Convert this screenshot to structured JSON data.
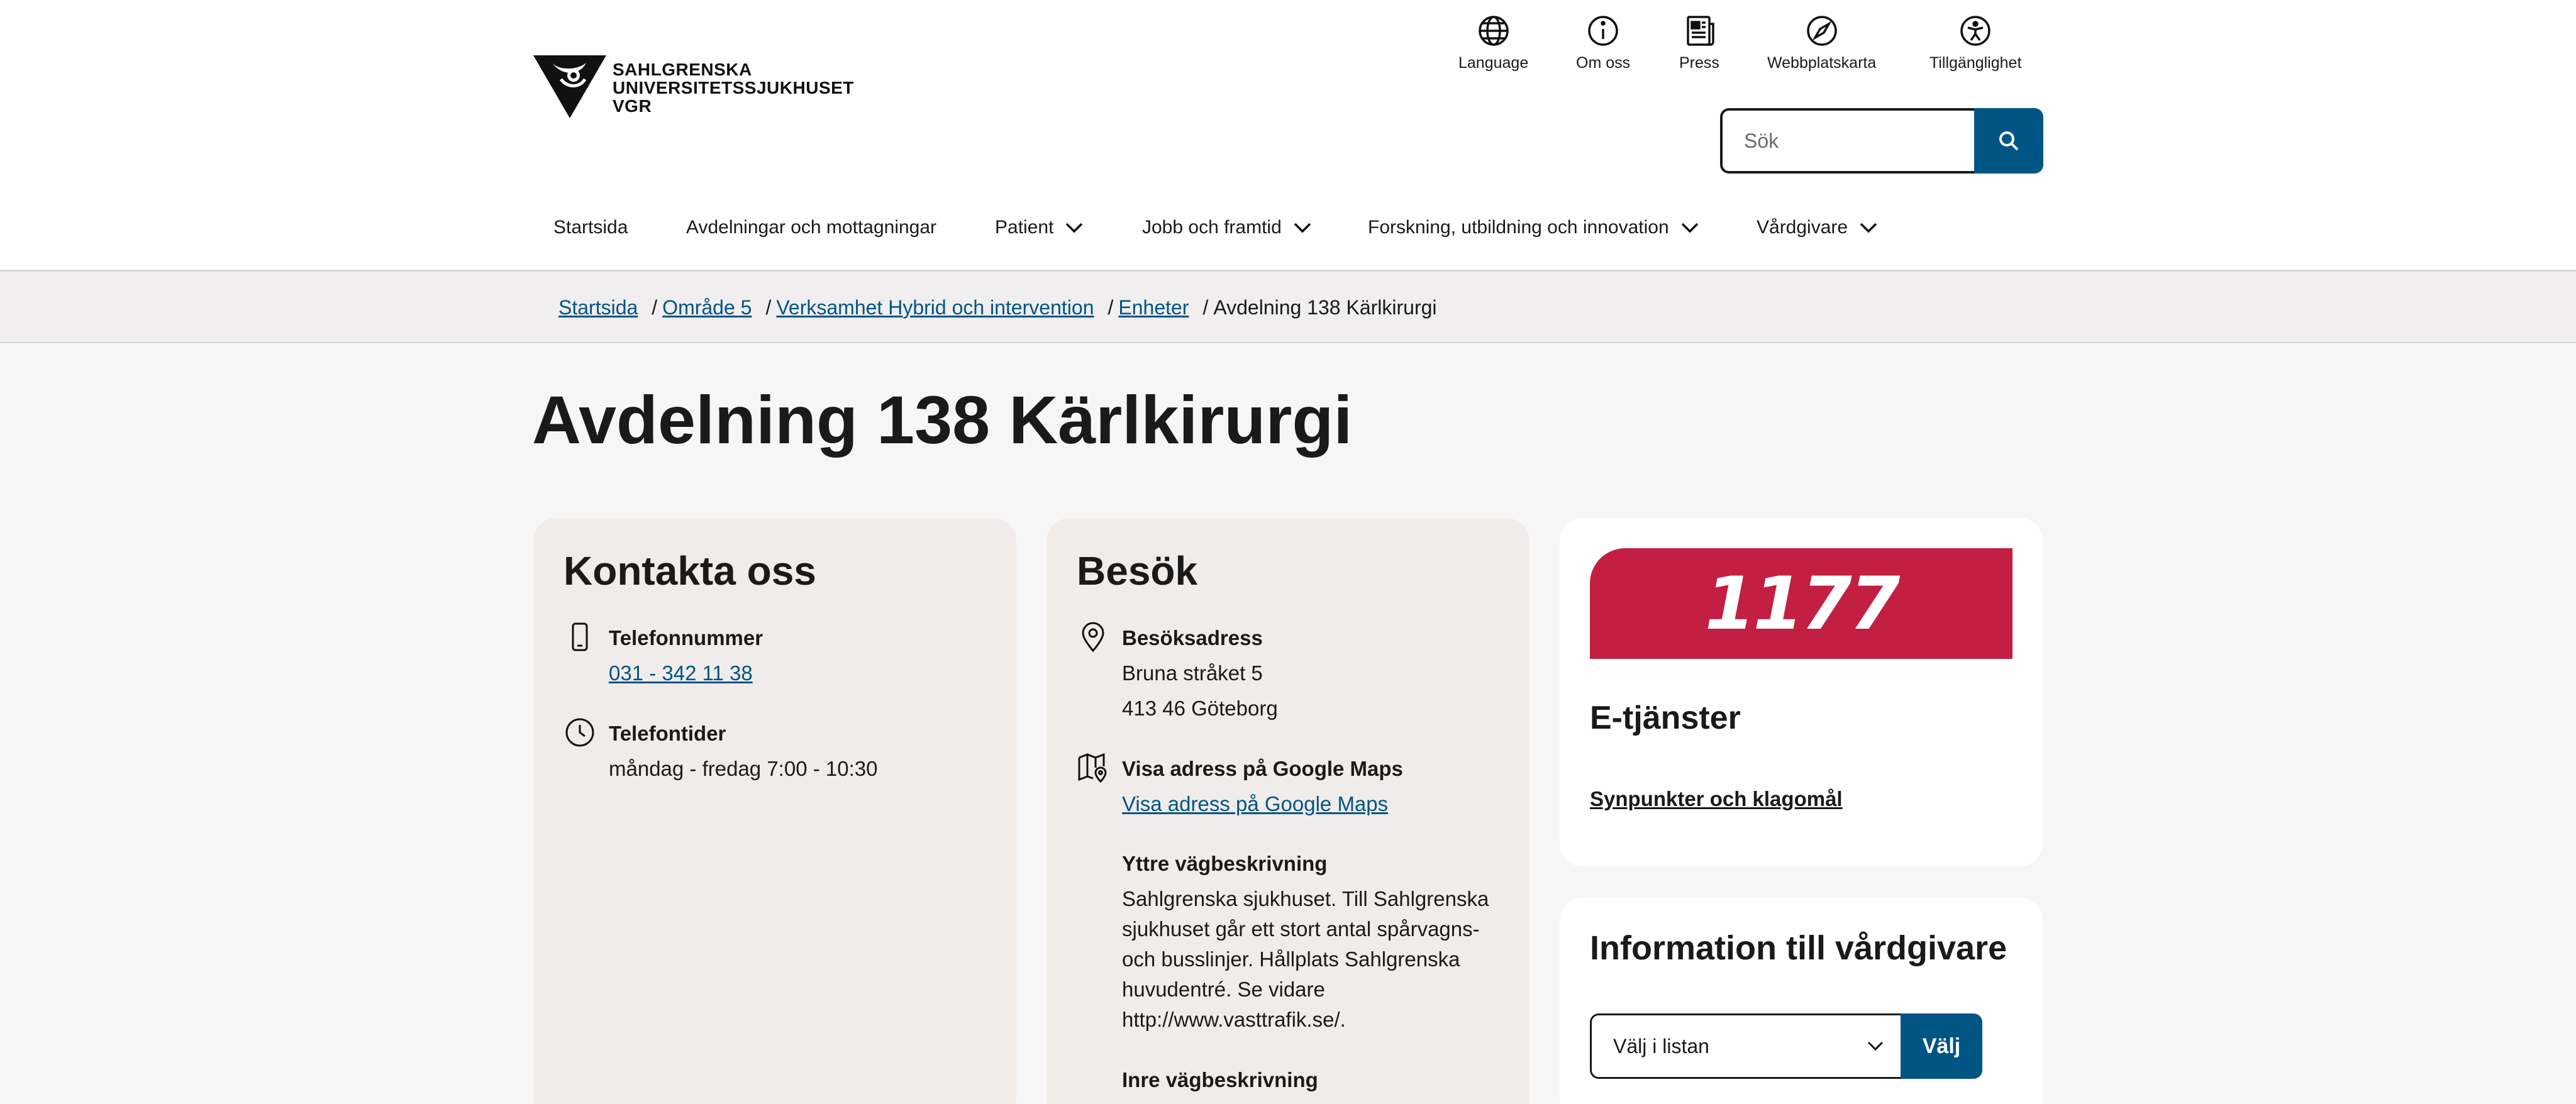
{
  "header": {
    "logo": {
      "line1": "SAHLGRENSKA",
      "line2": "UNIVERSITETSSJUKHUSET",
      "line3": "VGR"
    },
    "utility_nav": [
      {
        "label": "Language",
        "icon": "globe-icon"
      },
      {
        "label": "Om oss",
        "icon": "info-icon"
      },
      {
        "label": "Press",
        "icon": "newspaper-icon"
      },
      {
        "label": "Webbplatskarta",
        "icon": "compass-icon"
      },
      {
        "label": "Tillgänglighet",
        "icon": "accessibility-icon"
      }
    ],
    "search": {
      "placeholder": "Sök",
      "button_icon": "search-icon"
    },
    "main_nav": [
      {
        "label": "Startsida",
        "dropdown": false
      },
      {
        "label": "Avdelningar och mottagningar",
        "dropdown": false
      },
      {
        "label": "Patient",
        "dropdown": true
      },
      {
        "label": "Jobb och framtid",
        "dropdown": true
      },
      {
        "label": "Forskning, utbildning och innovation",
        "dropdown": true
      },
      {
        "label": "Vårdgivare",
        "dropdown": true
      }
    ]
  },
  "breadcrumb": {
    "links": [
      "Startsida",
      "Område 5",
      "Verksamhet Hybrid och intervention",
      "Enheter"
    ],
    "current": "Avdelning 138 Kärlkirurgi"
  },
  "page_title": "Avdelning 138 Kärlkirurgi",
  "contact": {
    "title": "Kontakta oss",
    "phone_label": "Telefonnummer",
    "phone_value": "031 - 342 11 38",
    "hours_label": "Telefontider",
    "hours_value": "måndag - fredag 7:00 - 10:30"
  },
  "visit": {
    "title": "Besök",
    "address_label": "Besöksadress",
    "address_line1": "Bruna stråket 5",
    "address_line2": "413 46 Göteborg",
    "maps_label": "Visa adress på Google Maps",
    "maps_link": "Visa adress på Google Maps",
    "outer_label": "Yttre vägbeskrivning",
    "outer_text": "Sahlgrenska sjukhuset. Till Sahlgrenska sjukhuset går ett stort antal spårvagns- och busslinjer. Hållplats Sahlgrenska huvudentré. Se vidare http://www.vasttrafik.se/.",
    "inner_label": "Inre vägbeskrivning"
  },
  "eservices": {
    "logo_text": "1177",
    "title": "E-tjänster",
    "link": "Synpunkter och klagomål"
  },
  "provider_info": {
    "title": "Information till vårdgivare",
    "select_value": "Välj i listan",
    "button": "Välj"
  },
  "colors": {
    "link": "#005585",
    "brand_1177": "#c21f43",
    "background": "#f7f6f6",
    "card": "#f0ecea"
  }
}
